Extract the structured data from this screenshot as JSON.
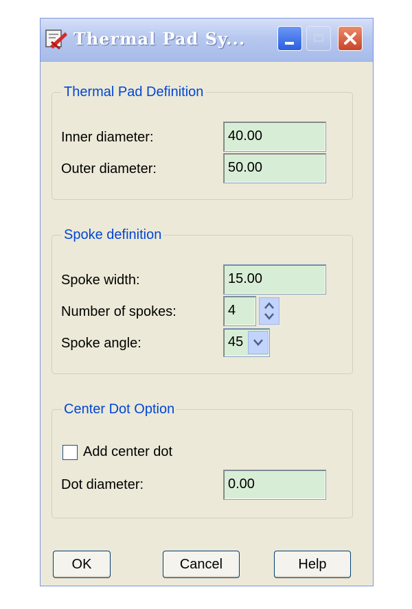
{
  "window": {
    "title": "Thermal Pad Sy..."
  },
  "groups": {
    "thermal_pad": {
      "legend": "Thermal Pad Definition",
      "inner_diameter_label": "Inner diameter:",
      "inner_diameter_value": "40.00",
      "outer_diameter_label": "Outer diameter:",
      "outer_diameter_value": "50.00"
    },
    "spoke": {
      "legend": "Spoke definition",
      "spoke_width_label": "Spoke width:",
      "spoke_width_value": "15.00",
      "num_spokes_label": "Number of spokes:",
      "num_spokes_value": "4",
      "spoke_angle_label": "Spoke angle:",
      "spoke_angle_value": "45"
    },
    "center_dot": {
      "legend": "Center Dot Option",
      "add_center_dot_label": "Add center dot",
      "add_center_dot_checked": false,
      "dot_diameter_label": "Dot diameter:",
      "dot_diameter_value": "0.00"
    }
  },
  "buttons": {
    "ok": "OK",
    "cancel": "Cancel",
    "help": "Help"
  },
  "icons": {
    "app": "pad-settings-icon",
    "minimize": "minimize-icon",
    "maximize": "maximize-icon",
    "close": "close-icon",
    "spin": "spinner-arrows-icon",
    "dropdown": "chevron-down-icon"
  },
  "colors": {
    "title_bar": "#b7c8ef",
    "group_legend": "#0046d5",
    "field_bg": "#d8edd6",
    "close_button": "#c8452a"
  }
}
